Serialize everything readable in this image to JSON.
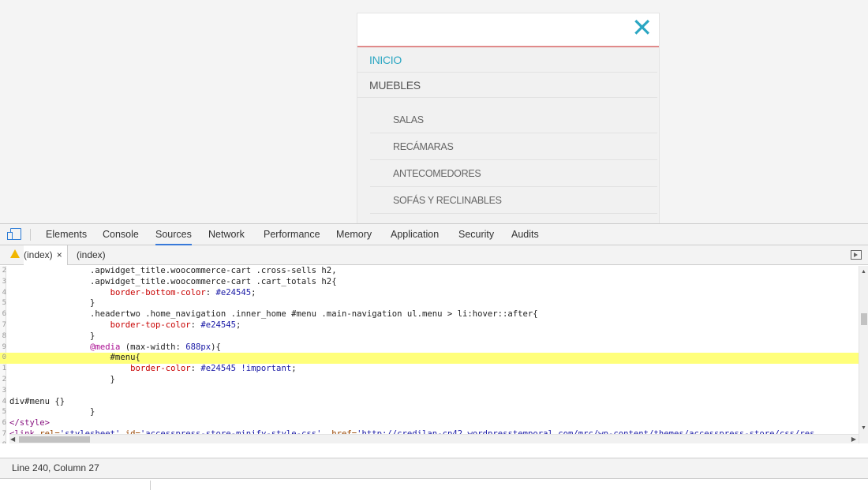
{
  "menu": {
    "close_icon": "✕",
    "top_items": [
      {
        "label": "INICIO",
        "active": true
      },
      {
        "label": "MUEBLES",
        "active": false
      }
    ],
    "sub_items": [
      "SALAS",
      "RECÁMARAS",
      "ANTECOMEDORES",
      "SOFÁS Y RECLINABLES"
    ],
    "accent_color": "#2aa6c2"
  },
  "devtools": {
    "tabs": [
      "Elements",
      "Console",
      "Sources",
      "Network",
      "Performance",
      "Memory",
      "Application",
      "Security",
      "Audits"
    ],
    "active_tab": "Sources",
    "file_tabs": [
      {
        "label": "(index)",
        "warning": true,
        "close": "×"
      },
      {
        "label": "(index)"
      }
    ],
    "code": [
      {
        "ln": "2",
        "parts": [
          [
            "",
            "                .apwidget_title.woocommerce-cart .cross-sells h2,"
          ]
        ]
      },
      {
        "ln": "3",
        "parts": [
          [
            "",
            "                .apwidget_title.woocommerce-cart .cart_totals h2{"
          ]
        ]
      },
      {
        "ln": "4",
        "parts": [
          [
            "",
            "                    "
          ],
          [
            "prop",
            "border-bottom-color"
          ],
          [
            "",
            ": "
          ],
          [
            "val",
            "#e24545"
          ],
          [
            "",
            ";"
          ]
        ]
      },
      {
        "ln": "5",
        "parts": [
          [
            "",
            "                }"
          ]
        ]
      },
      {
        "ln": "6",
        "parts": [
          [
            "",
            "                .headertwo .home_navigation .inner_home #menu .main-navigation ul.menu > li:hover::after{"
          ]
        ]
      },
      {
        "ln": "7",
        "parts": [
          [
            "",
            "                    "
          ],
          [
            "prop",
            "border-top-color"
          ],
          [
            "",
            ": "
          ],
          [
            "val",
            "#e24545"
          ],
          [
            "",
            ";"
          ]
        ]
      },
      {
        "ln": "8",
        "parts": [
          [
            "",
            "                }"
          ]
        ]
      },
      {
        "ln": "9",
        "parts": [
          [
            "",
            "                "
          ],
          [
            "kw",
            "@media"
          ],
          [
            "",
            " (max-width: "
          ],
          [
            "val",
            "688px"
          ],
          [
            "",
            "){"
          ]
        ]
      },
      {
        "ln": "0",
        "hl": true,
        "parts": [
          [
            "",
            "                    #menu{"
          ]
        ]
      },
      {
        "ln": "1",
        "parts": [
          [
            "",
            "                        "
          ],
          [
            "prop",
            "border-color"
          ],
          [
            "",
            ": "
          ],
          [
            "val",
            "#e24545 !important"
          ],
          [
            "",
            ";"
          ]
        ]
      },
      {
        "ln": "2",
        "parts": [
          [
            "",
            "                    }"
          ]
        ]
      },
      {
        "ln": "3",
        "parts": [
          [
            "",
            ""
          ]
        ]
      },
      {
        "ln": "4",
        "parts": [
          [
            "",
            "div#menu {}"
          ]
        ]
      },
      {
        "ln": "5",
        "parts": [
          [
            "",
            "                }"
          ]
        ]
      },
      {
        "ln": "6",
        "parts": [
          [
            "tag",
            "</style>"
          ]
        ]
      },
      {
        "ln": "7",
        "parts": [
          [
            "tag",
            "<link "
          ],
          [
            "attr",
            "rel="
          ],
          [
            "str",
            "'stylesheet'"
          ],
          [
            "",
            " "
          ],
          [
            "attr",
            "id="
          ],
          [
            "str",
            "'accesspress-store-minify-style-css'"
          ],
          [
            "",
            "  "
          ],
          [
            "attr",
            "href="
          ],
          [
            "str",
            "'http://credilan-cp42.wordpresstemporal.com/mrc/wp-content/themes/accesspress-store/css/res"
          ]
        ]
      },
      {
        "ln": "8",
        "parts": [
          [
            "",
            ""
          ]
        ]
      }
    ],
    "status": "Line 240, Column 27"
  }
}
